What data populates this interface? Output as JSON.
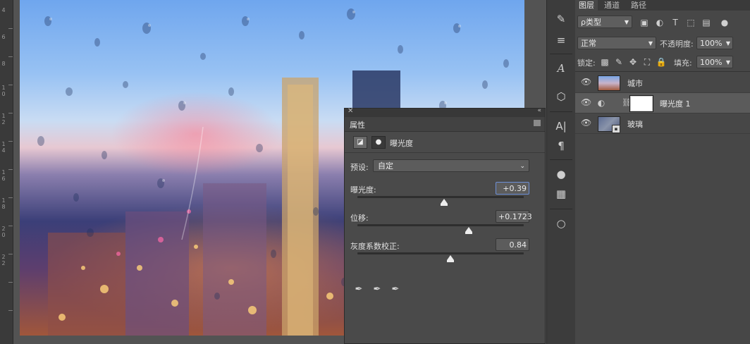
{
  "ruler": {
    "labels": [
      "4",
      "6",
      "8",
      "1 0",
      "1 2",
      "1 4",
      "1 6",
      "1 8",
      "2 0",
      "2 2"
    ]
  },
  "canvas": {
    "alt": "rain on window city night photo"
  },
  "toolstrip": {
    "icons": [
      "brush-settings-icon",
      "adjust-sliders-icon",
      "type-a-icon",
      "3d-cube-icon",
      "character-icon",
      "paragraph-icon",
      "palette-icon",
      "grid-icon",
      "bulb-icon"
    ]
  },
  "layers_panel": {
    "tabs": [
      "图层",
      "通道",
      "路径"
    ],
    "filter": {
      "label": "ρ类型"
    },
    "blend_mode": "正常",
    "opacity_label": "不透明度:",
    "opacity_value": "100%",
    "lock_label": "锁定:",
    "fill_label": "填充:",
    "fill_value": "100%",
    "layers": [
      {
        "name": "城市"
      },
      {
        "name": "曝光度 1"
      },
      {
        "name": "玻璃"
      }
    ]
  },
  "properties_panel": {
    "title": "属性",
    "section_title": "曝光度",
    "preset_label": "预设:",
    "preset_value": "自定",
    "sliders": [
      {
        "label": "曝光度:",
        "value": "+0.39",
        "position": 0.52
      },
      {
        "label": "位移:",
        "value": "+0.1723",
        "position": 0.67
      },
      {
        "label": "灰度系数校正:",
        "value": "0.84",
        "position": 0.56
      }
    ]
  }
}
